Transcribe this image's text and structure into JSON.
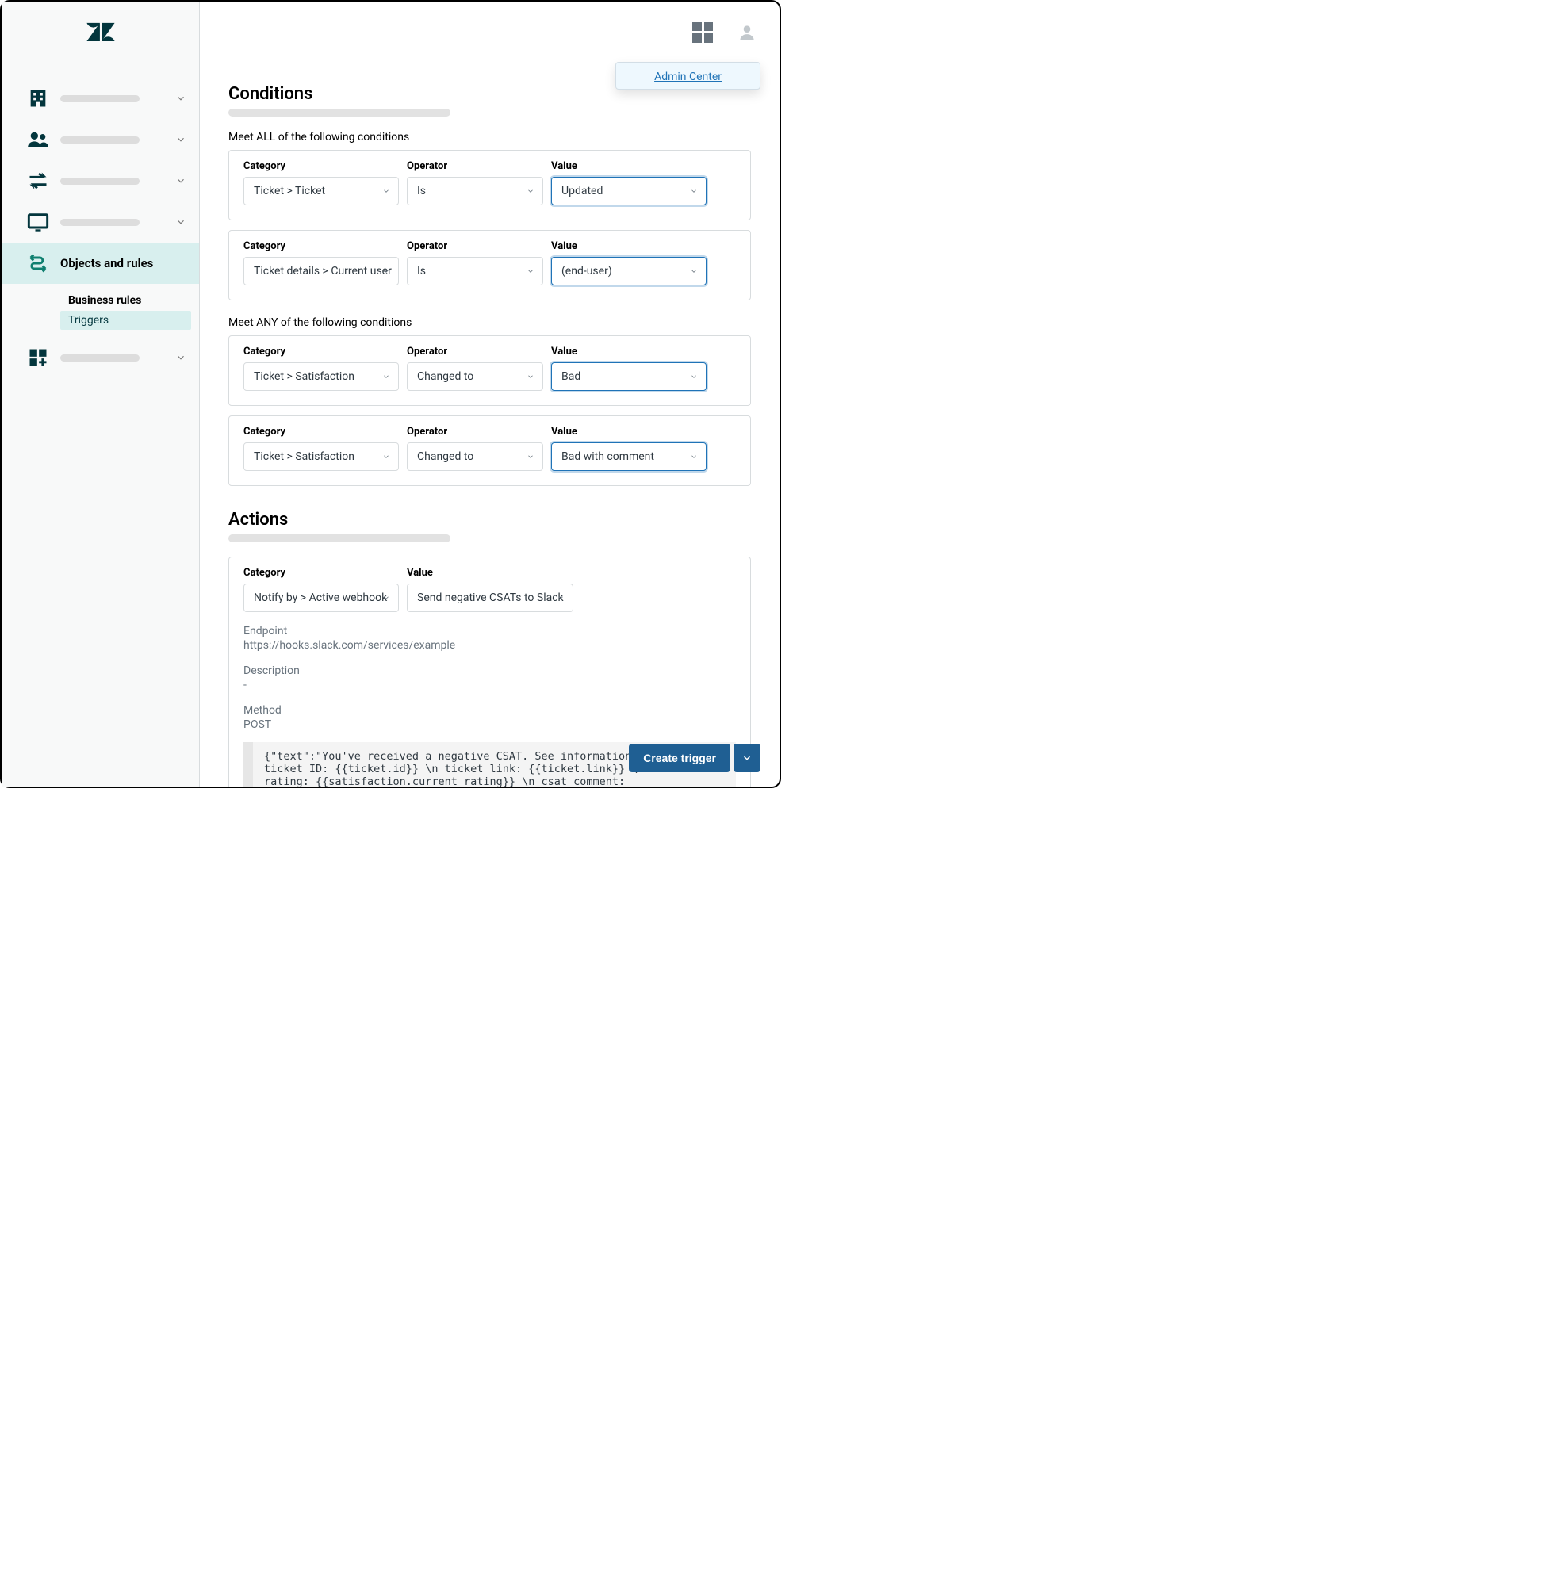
{
  "popup": {
    "admin_center": "Admin Center"
  },
  "sidebar": {
    "active_label": "Objects and rules",
    "sub": {
      "business_rules": "Business rules",
      "triggers": "Triggers"
    }
  },
  "sections": {
    "conditions_title": "Conditions",
    "meet_all": "Meet ALL of the following conditions",
    "meet_any": "Meet ANY of the following conditions",
    "actions_title": "Actions"
  },
  "labels": {
    "category": "Category",
    "operator": "Operator",
    "value": "Value"
  },
  "all_conditions": [
    {
      "category": "Ticket > Ticket",
      "operator": "Is",
      "value": "Updated"
    },
    {
      "category": "Ticket details > Current user",
      "operator": "Is",
      "value": "(end-user)"
    }
  ],
  "any_conditions": [
    {
      "category": "Ticket > Satisfaction",
      "operator": "Changed to",
      "value": "Bad"
    },
    {
      "category": "Ticket > Satisfaction",
      "operator": "Changed to",
      "value": "Bad with comment"
    }
  ],
  "action": {
    "category": "Notify by > Active webhook",
    "value": "Send negative CSATs to Slack",
    "endpoint_label": "Endpoint",
    "endpoint_value": "https://hooks.slack.com/services/example",
    "description_label": "Description",
    "description_value": "-",
    "method_label": "Method",
    "method_value": "POST",
    "body": "{\"text\":\"You've received a negative CSAT. See information below \\n ticket ID: {{ticket.id}} \\n ticket link: {{ticket.link}} \\n csat rating: {{satisfaction.current_rating}} \\n csat comment: {{satisfaction.current_comment}}\"}"
  },
  "footer": {
    "create_trigger": "Create trigger"
  }
}
